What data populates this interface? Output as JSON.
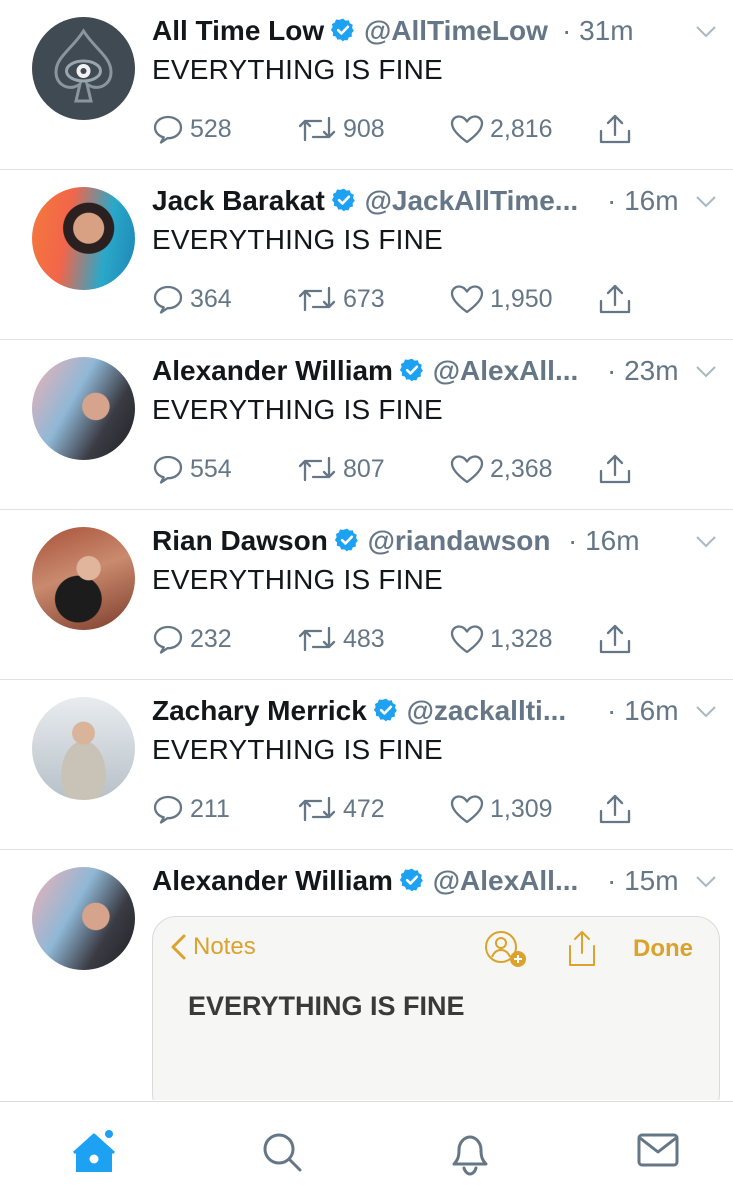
{
  "colors": {
    "accent": "#1da1f2",
    "secondary_text": "#657786",
    "notes_accent": "#dba22c"
  },
  "tweets": [
    {
      "name": "All Time Low",
      "handle": "@AllTimeLow",
      "time": "· 31m",
      "text": "EVERYTHING IS FINE",
      "replies": "528",
      "retweets": "908",
      "likes": "2,816"
    },
    {
      "name": "Jack Barakat",
      "handle": "@JackAllTime...",
      "time": "· 16m",
      "text": "EVERYTHING IS FINE",
      "replies": "364",
      "retweets": "673",
      "likes": "1,950"
    },
    {
      "name": "Alexander William",
      "handle": "@AlexAll...",
      "time": "· 23m",
      "text": "EVERYTHING IS FINE",
      "replies": "554",
      "retweets": "807",
      "likes": "2,368"
    },
    {
      "name": "Rian Dawson",
      "handle": "@riandawson",
      "time": "· 16m",
      "text": "EVERYTHING IS FINE",
      "replies": "232",
      "retweets": "483",
      "likes": "1,328"
    },
    {
      "name": "Zachary Merrick",
      "handle": "@zackallti...",
      "time": "· 16m",
      "text": "EVERYTHING IS FINE",
      "replies": "211",
      "retweets": "472",
      "likes": "1,309"
    },
    {
      "name": "Alexander William",
      "handle": "@AlexAll...",
      "time": "· 15m"
    }
  ],
  "notes_card": {
    "back_label": "Notes",
    "done_label": "Done",
    "title": "EVERYTHING IS FINE"
  },
  "tabbar": {
    "items": [
      "home-icon",
      "search-icon",
      "notifications-icon",
      "messages-icon"
    ],
    "active": "home-icon"
  }
}
